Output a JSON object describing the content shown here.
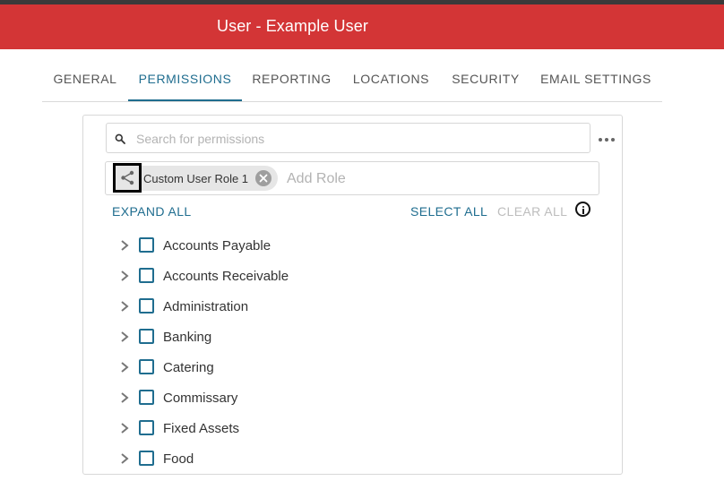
{
  "header": {
    "title": "User - Example User"
  },
  "tabs": [
    {
      "label": "GENERAL",
      "active": false
    },
    {
      "label": "PERMISSIONS",
      "active": true
    },
    {
      "label": "REPORTING",
      "active": false
    },
    {
      "label": "LOCATIONS",
      "active": false
    },
    {
      "label": "SECURITY",
      "active": false
    },
    {
      "label": "EMAIL SETTINGS",
      "active": false
    }
  ],
  "search": {
    "placeholder": "Search for permissions",
    "value": ""
  },
  "roles": {
    "chips": [
      {
        "label": "Custom User Role 1"
      }
    ],
    "add_placeholder": "Add Role"
  },
  "actions": {
    "expand_all": "EXPAND ALL",
    "select_all": "SELECT ALL",
    "clear_all": "CLEAR ALL"
  },
  "permissions": [
    {
      "label": "Accounts Payable",
      "checked": false
    },
    {
      "label": "Accounts Receivable",
      "checked": false
    },
    {
      "label": "Administration",
      "checked": false
    },
    {
      "label": "Banking",
      "checked": false
    },
    {
      "label": "Catering",
      "checked": false
    },
    {
      "label": "Commissary",
      "checked": false
    },
    {
      "label": "Fixed Assets",
      "checked": false
    },
    {
      "label": "Food",
      "checked": false
    }
  ],
  "colors": {
    "header_bg": "#d33536",
    "accent": "#1f6d8f",
    "disabled": "#bdbdbd"
  }
}
